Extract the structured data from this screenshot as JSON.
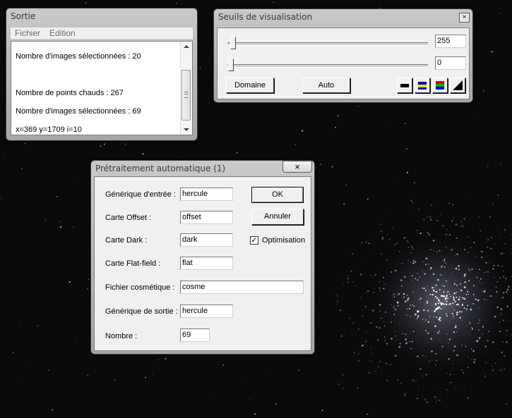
{
  "sortie": {
    "title": "Sortie",
    "menu": [
      "Fichier",
      "Edition"
    ],
    "lines": [
      "Nombre d'images sélectionnées : 20",
      "",
      "",
      "Nombre de points chauds : 267",
      "Nombre d'images sélectionnées : 69",
      "x=369  y=1709  i=10"
    ]
  },
  "seuils": {
    "title": "Seuils de visualisation",
    "high_value": "255",
    "low_value": "0",
    "domaine_label": "Domaine",
    "auto_label": "Auto",
    "palette_icons": [
      "black-bar-icon",
      "blue-yellow-palette-icon",
      "rgb-palette-icon",
      "gradient-triangle-icon"
    ]
  },
  "pretraitement": {
    "title": "Prétraitement automatique (1)",
    "fields": {
      "generique_entree": {
        "label": "Générique d'entrée :",
        "value": "hercule"
      },
      "carte_offset": {
        "label": "Carte Offset :",
        "value": "offset"
      },
      "carte_dark": {
        "label": "Carte Dark :",
        "value": "dark"
      },
      "carte_flat": {
        "label": "Carte Flat-field :",
        "value": "flat"
      },
      "fichier_cosmetique": {
        "label": "Fichier cosmétique :",
        "value": "cosme"
      },
      "generique_sortie": {
        "label": "Générique de sortie :",
        "value": "hercule"
      },
      "nombre": {
        "label": "Nombre :",
        "value": "69"
      }
    },
    "ok_label": "OK",
    "annuler_label": "Annuler",
    "optimisation_label": "Optimisation",
    "optimisation_checked": true
  }
}
